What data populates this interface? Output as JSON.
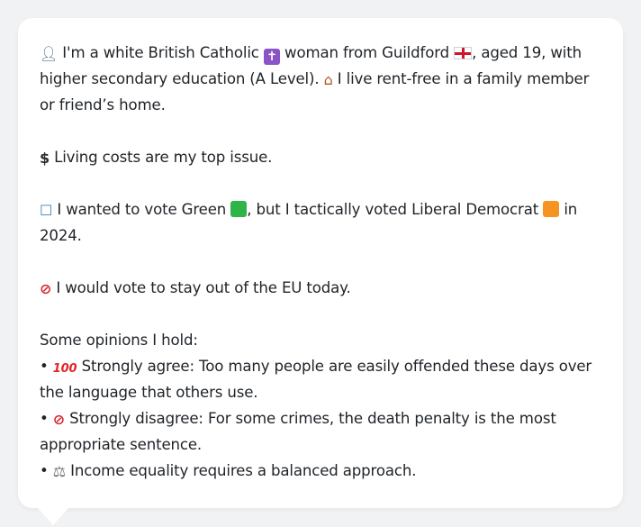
{
  "profile": {
    "intro_a": "I'm a white British Catholic",
    "intro_b": "woman from Guildford",
    "intro_c": ", aged 19, with higher secondary education (A Level).",
    "intro_d": "I live rent-free in a family member or friend’s home."
  },
  "issue": {
    "text": "Living costs are my top issue."
  },
  "vote": {
    "text_a": "I wanted to vote Green",
    "text_b": ", but I tactically voted Liberal Democrat",
    "text_c": "in 2024."
  },
  "eu": {
    "text": "I would vote to stay out of the EU today."
  },
  "opinions": {
    "heading": "Some opinions I hold:",
    "items": [
      {
        "bullet": "•",
        "text": "Strongly agree: Too many people are easily offended these days over the language that others use."
      },
      {
        "bullet": "•",
        "text": "Strongly disagree: For some crimes, the death penalty is the most appropriate sentence."
      },
      {
        "bullet": "•",
        "text": "Income equality requires a balanced approach."
      }
    ]
  },
  "icons": {
    "person": "person-icon",
    "religion": "latin-cross-icon",
    "flag": "england-flag-icon",
    "home": "house-icon",
    "money": "dollar-sign-icon",
    "ballot": "ballot-box-icon",
    "green_party": "green-square-icon",
    "lib_dem": "orange-square-icon",
    "no_entry": "prohibited-icon",
    "hundred": "hundred-points-icon",
    "scales": "balance-scale-icon"
  },
  "colors": {
    "green": "#2fb44a",
    "orange": "#f79321",
    "purple": "#8a53c6",
    "red": "#d7262e"
  }
}
